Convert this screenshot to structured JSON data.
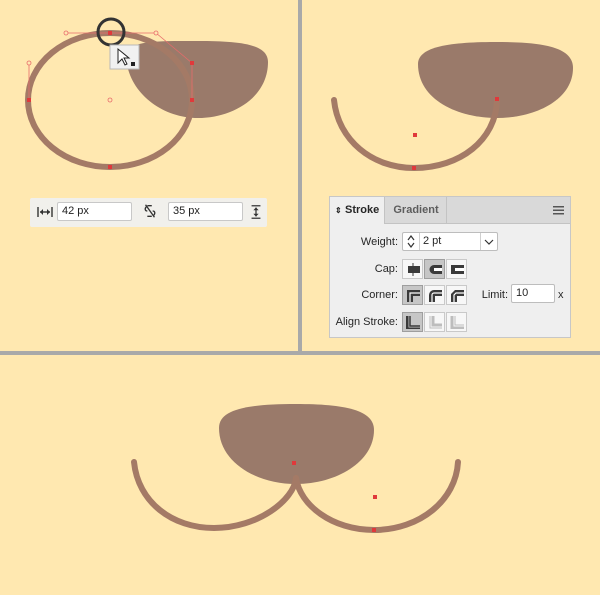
{
  "size_controls": {
    "width_value": "42 px",
    "height_value": "35 px",
    "width_icon": "width-arrows-icon",
    "link_icon": "unlink-icon",
    "height_icon": "height-arrows-icon"
  },
  "stroke_panel": {
    "tabs": [
      {
        "label": "Stroke",
        "active": true
      },
      {
        "label": "Gradient",
        "active": false
      }
    ],
    "weight_label": "Weight:",
    "weight_value": "2 pt",
    "cap_label": "Cap:",
    "cap_options": [
      "butt-cap",
      "round-cap",
      "projecting-cap"
    ],
    "cap_selected": "round-cap",
    "corner_label": "Corner:",
    "corner_options": [
      "miter-join",
      "round-join",
      "bevel-join"
    ],
    "corner_selected": "miter-join",
    "limit_label": "Limit:",
    "limit_value": "10",
    "limit_unit": "x",
    "align_label": "Align Stroke:",
    "align_options": [
      "align-center",
      "align-inside",
      "align-outside"
    ],
    "align_selected": "align-center"
  },
  "colors": {
    "background": "#ffe8b0",
    "shape_fill": "#9a7a6a",
    "stroke": "#a47a66",
    "anchor": "#e0393b",
    "divider": "#a9a9a9"
  }
}
